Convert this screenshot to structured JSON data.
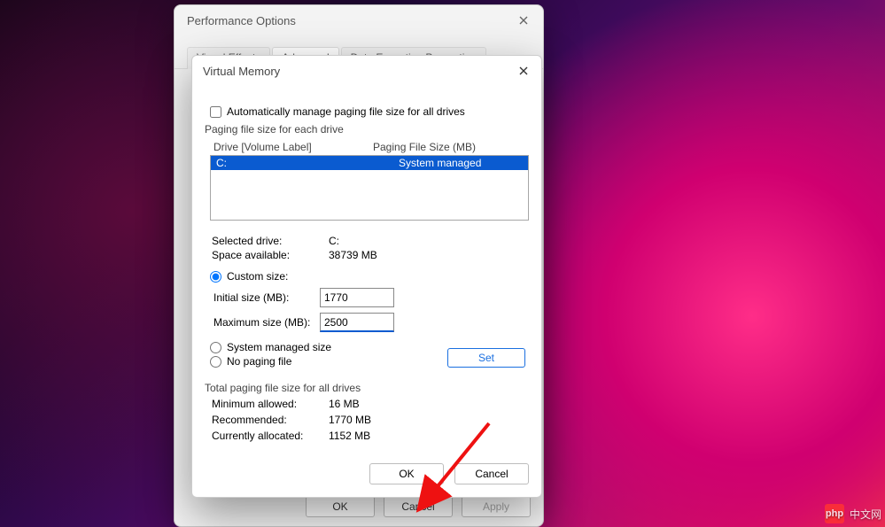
{
  "perf": {
    "title": "Performance Options",
    "tabs": [
      "Visual Effects",
      "Advanced",
      "Data Execution Prevention"
    ],
    "active_tab": 1,
    "buttons": {
      "ok": "OK",
      "cancel": "Cancel",
      "apply": "Apply"
    }
  },
  "vm": {
    "title": "Virtual Memory",
    "auto_manage": "Automatically manage paging file size for all drives",
    "group_label": "Paging file size for each drive",
    "list_headers": {
      "drive": "Drive  [Volume Label]",
      "size": "Paging File Size (MB)"
    },
    "drives": [
      {
        "name": "C:",
        "size": "System managed",
        "selected": true
      }
    ],
    "selected_drive_label": "Selected drive:",
    "selected_drive": "C:",
    "space_label": "Space available:",
    "space_value": "38739 MB",
    "custom_size": "Custom size:",
    "initial_label": "Initial size (MB):",
    "initial_value": "1770",
    "max_label": "Maximum size (MB):",
    "max_value": "2500",
    "system_managed": "System managed size",
    "no_paging": "No paging file",
    "set": "Set",
    "totals_label": "Total paging file size for all drives",
    "min_label": "Minimum allowed:",
    "min_value": "16 MB",
    "rec_label": "Recommended:",
    "rec_value": "1770 MB",
    "cur_label": "Currently allocated:",
    "cur_value": "1152 MB",
    "buttons": {
      "ok": "OK",
      "cancel": "Cancel"
    }
  },
  "watermark": {
    "brand": "php",
    "text": "中文网"
  }
}
